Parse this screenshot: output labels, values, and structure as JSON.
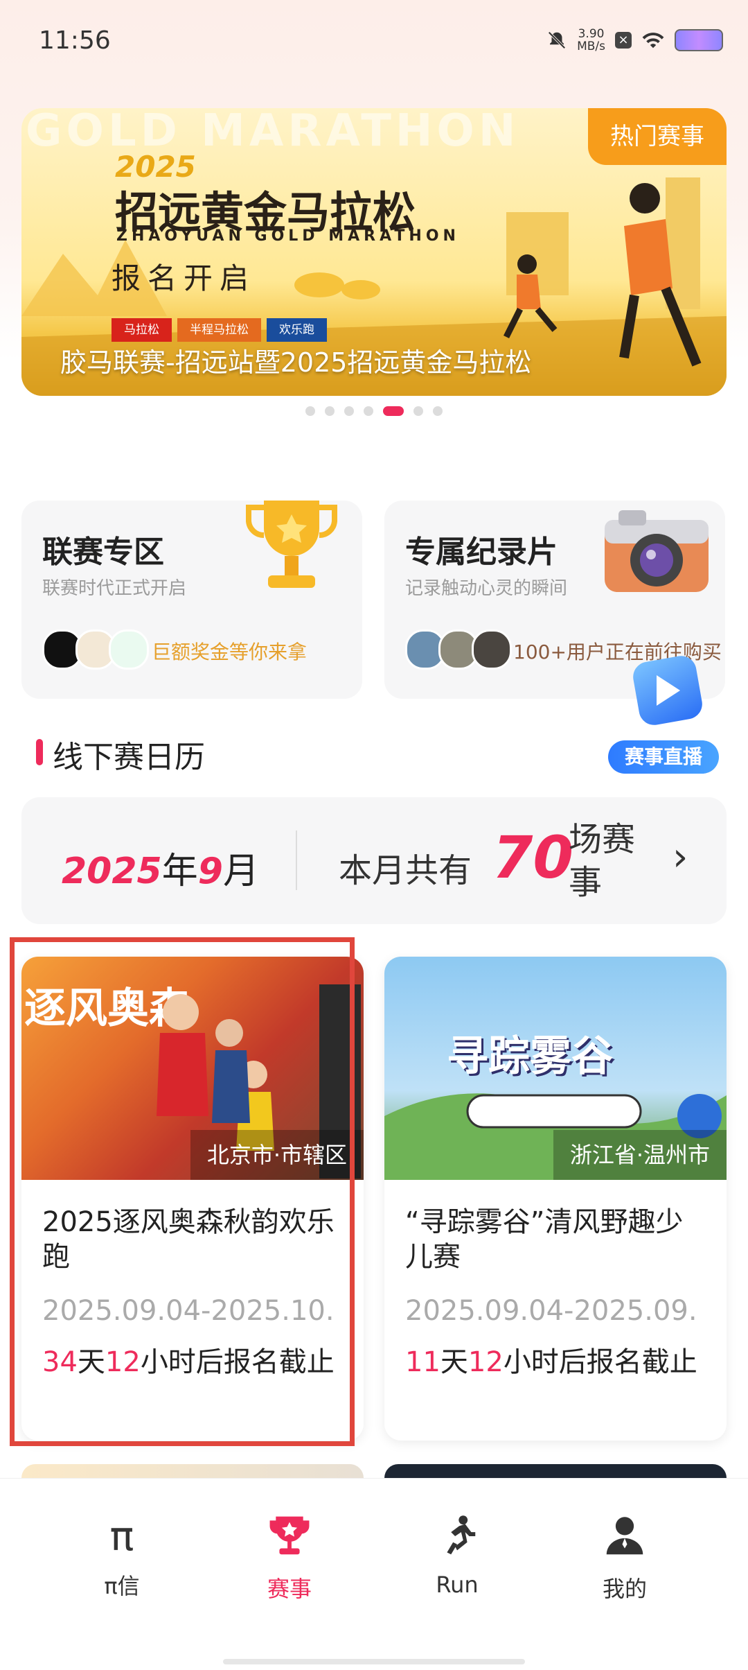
{
  "status_bar": {
    "time": "11:56",
    "speed_value": "3.90",
    "speed_unit": "MB/s"
  },
  "banner": {
    "bg_word": "GOLD MARATHON",
    "hot_tag": "热门赛事",
    "year": "2025",
    "title": "招远黄金马拉松",
    "title_en": "ZHAOYUAN GOLD MARATHON",
    "open_text": "报名开启",
    "badges": [
      "马拉松",
      "半程马拉松",
      "欢乐跑"
    ],
    "caption": "胶马联赛-招远站暨2025招远黄金马拉松",
    "page_count": 7,
    "active_page": 4
  },
  "features": [
    {
      "title": "联赛专区",
      "subtitle": "联赛时代正式开启",
      "note": "巨额奖金等你来拿",
      "icon": "trophy-icon"
    },
    {
      "title": "专属纪录片",
      "subtitle": "记录触动心灵的瞬间",
      "note": "100+用户正在前往购买",
      "icon": "camera-icon"
    }
  ],
  "live": {
    "label": "赛事直播"
  },
  "calendar": {
    "section_title": "线下赛日历",
    "year": "2025",
    "year_unit": "年",
    "month": "9",
    "month_unit": "月",
    "count_prefix": "本月共有",
    "count": "70",
    "count_suffix": "场赛事"
  },
  "events": [
    {
      "image_word": "逐风奥森",
      "location": "北京市·市辖区",
      "title": "2025逐风奥森秋韵欢乐跑",
      "date": "2025.09.04-2025.10.",
      "days": "34",
      "days_unit": "天",
      "hours": "12",
      "tail": "小时后报名截止"
    },
    {
      "image_word": "寻踪雾谷",
      "location": "浙江省·温州市",
      "title": "“寻踪雾谷”清风野趣少儿赛",
      "date": "2025.09.04-2025.09.",
      "days": "11",
      "days_unit": "天",
      "hours": "12",
      "tail": "小时后报名截止"
    }
  ],
  "nav": [
    {
      "label": "π信",
      "icon": "pi-icon"
    },
    {
      "label": "赛事",
      "icon": "trophy-icon"
    },
    {
      "label": "Run",
      "icon": "runner-icon"
    },
    {
      "label": "我的",
      "icon": "user-icon"
    }
  ],
  "colors": {
    "accent": "#ee2b5b",
    "highlight_border": "#e0463c"
  }
}
